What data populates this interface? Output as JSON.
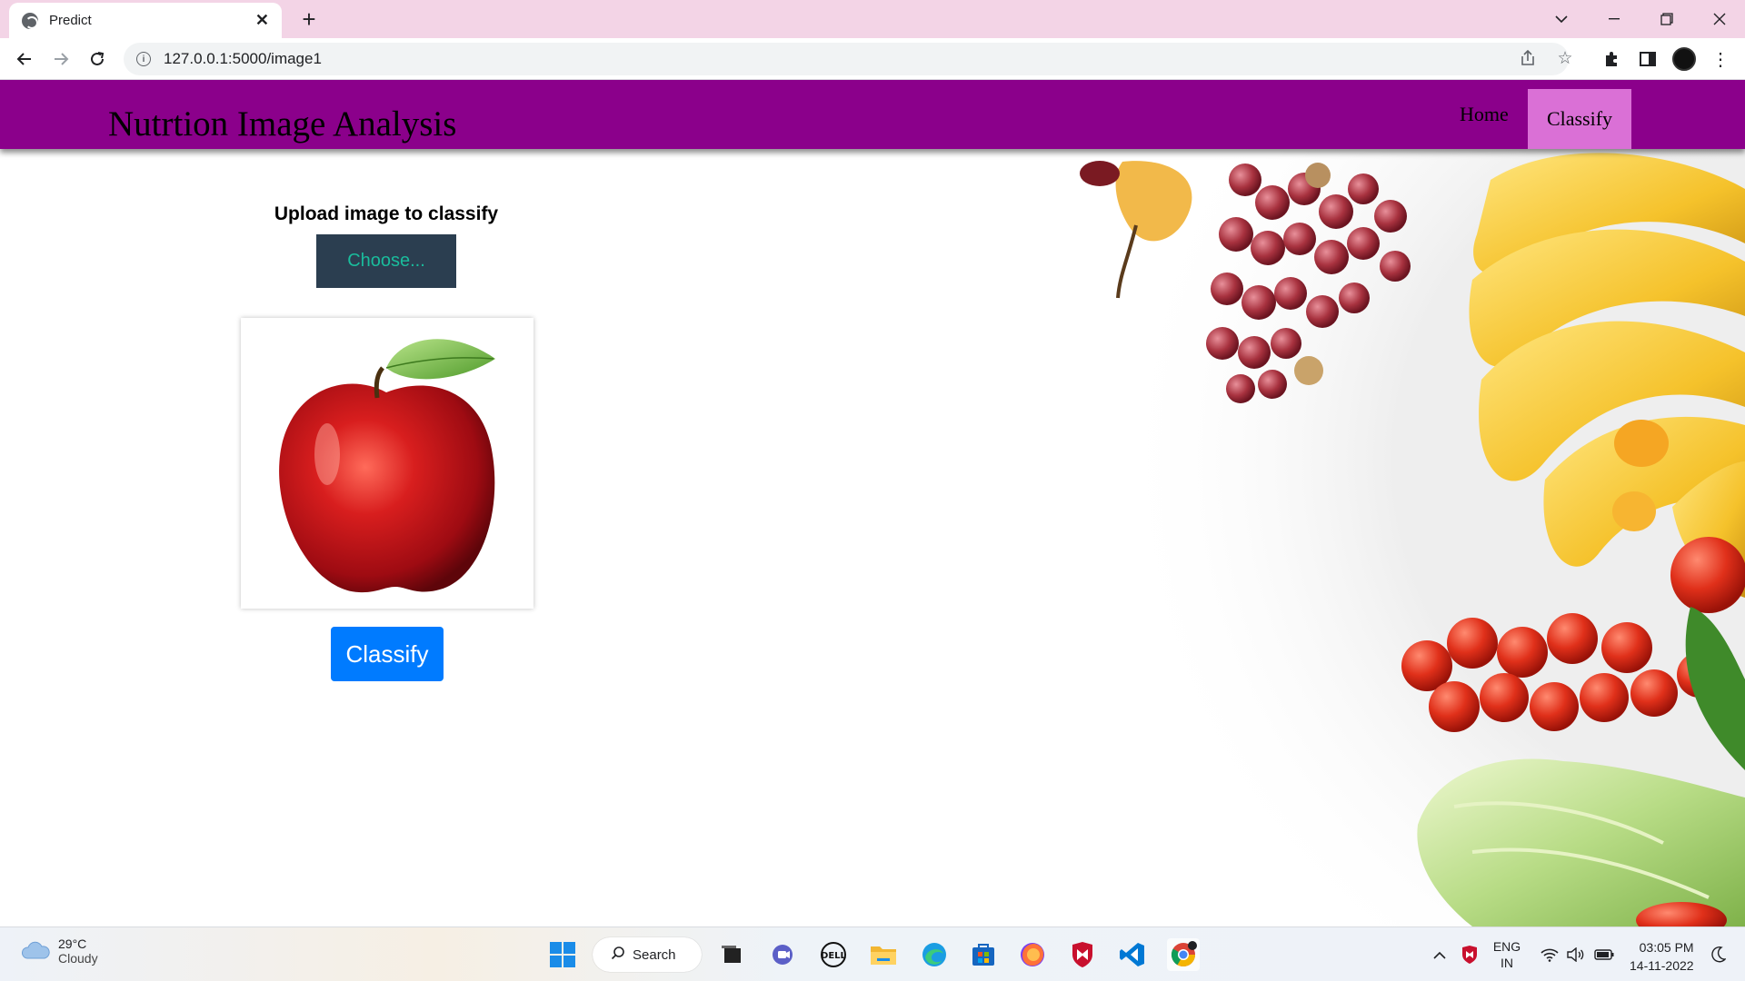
{
  "browser": {
    "tab_title": "Predict",
    "url": "127.0.0.1:5000/image1"
  },
  "navbar": {
    "brand": "Nutrtion Image Analysis",
    "links": [
      {
        "label": "Home",
        "active": false
      },
      {
        "label": "Classify",
        "active": true
      }
    ]
  },
  "upload": {
    "label": "Upload image to classify",
    "choose_label": "Choose...",
    "preview_subject": "red apple"
  },
  "classify_button": "Classify",
  "taskbar": {
    "weather_temp": "29°C",
    "weather_desc": "Cloudy",
    "search_label": "Search",
    "lang_top": "ENG",
    "lang_bottom": "IN",
    "time": "03:05 PM",
    "date": "14-11-2022"
  },
  "colors": {
    "navbar_bg": "#8b008b",
    "nav_active_bg": "#da70d6",
    "choose_bg": "#2b3e50",
    "choose_text": "#1abc9c",
    "classify_bg": "#007bff",
    "tab_strip": "#f3d4e6"
  }
}
